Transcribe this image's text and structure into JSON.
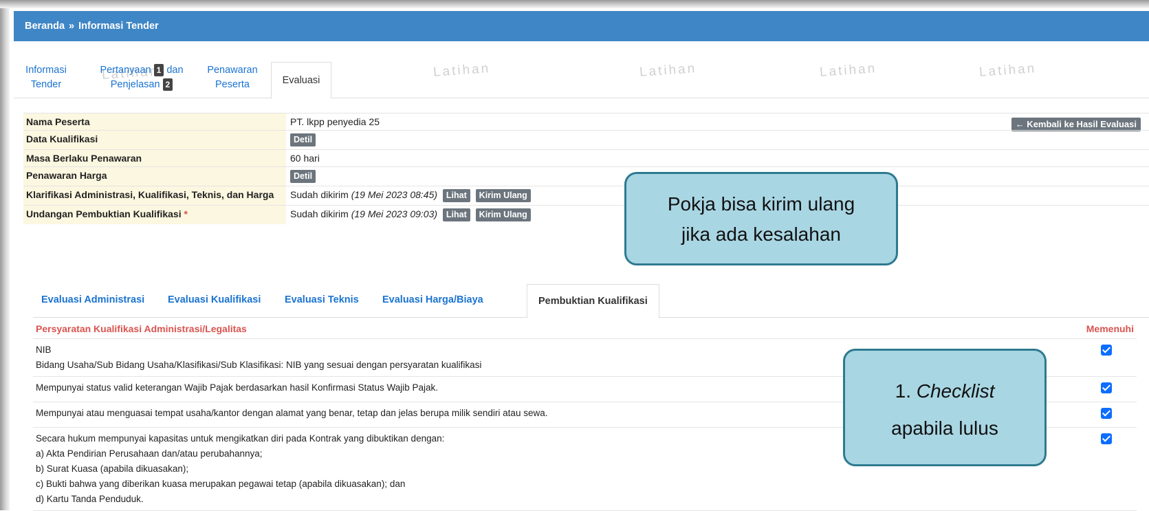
{
  "header": {
    "home": "Beranda",
    "separator": "»",
    "current": "Informasi Tender"
  },
  "tabs": [
    {
      "line1": "Informasi",
      "line2": "Tender"
    },
    {
      "line1": "Pertanyaan",
      "badge1": "1",
      "mid": "dan",
      "line2": "Penjelasan",
      "badge2": "2"
    },
    {
      "line1": "Penawaran",
      "line2": "Peserta"
    },
    {
      "line1": "Evaluasi"
    }
  ],
  "watermark": "Latihan",
  "info": {
    "rows": [
      {
        "label": "Nama Peserta",
        "value": "PT. lkpp penyedia 25"
      },
      {
        "label": "Data Kualifikasi",
        "button": "Detil"
      },
      {
        "label": "Masa Berlaku Penawaran",
        "value": "60 hari"
      },
      {
        "label": "Penawaran Harga",
        "button": "Detil"
      },
      {
        "label": "Klarifikasi Administrasi, Kualifikasi, Teknis, dan Harga",
        "value": "Sudah dikirim",
        "date": "(19 Mei 2023 08:45)",
        "btn1": "Lihat",
        "btn2": "Kirim Ulang"
      },
      {
        "label": "Undangan Pembuktian Kualifikasi",
        "required": "*",
        "value": "Sudah dikirim",
        "date": "(19 Mei 2023 09:03)",
        "btn1": "Lihat",
        "btn2": "Kirim Ulang"
      }
    ],
    "back_button": "← Kembali ke Hasil Evaluasi"
  },
  "subtabs": [
    "Evaluasi Administrasi",
    "Evaluasi Kualifikasi",
    "Evaluasi Teknis",
    "Evaluasi Harga/Biaya",
    "Pembuktian Kualifikasi"
  ],
  "requirements": {
    "header": "Persyaratan Kualifikasi Administrasi/Legalitas",
    "status_header": "Memenuhi",
    "items": [
      {
        "lines": [
          "NIB",
          "Bidang Usaha/Sub Bidang Usaha/Klasifikasi/Sub Klasifikasi: NIB yang sesuai dengan persyaratan kualifikasi"
        ],
        "checked": true
      },
      {
        "lines": [
          "Mempunyai status valid keterangan Wajib Pajak berdasarkan hasil Konfirmasi Status Wajib Pajak."
        ],
        "checked": true
      },
      {
        "lines": [
          "Mempunyai atau menguasai tempat usaha/kantor dengan alamat yang benar, tetap dan jelas berupa milik sendiri atau sewa."
        ],
        "checked": true
      },
      {
        "lines": [
          "Secara hukum mempunyai kapasitas untuk mengikatkan diri pada Kontrak yang dibuktikan dengan:",
          "a) Akta Pendirian Perusahaan dan/atau perubahannya;",
          "b) Surat Kuasa (apabila dikuasakan);",
          "c) Bukti bahwa yang diberikan kuasa merupakan pegawai tetap (apabila dikuasakan); dan",
          "d) Kartu Tanda Penduduk."
        ],
        "checked": true
      }
    ]
  },
  "callouts": {
    "top": {
      "line1": "Pokja bisa kirim ulang",
      "line2": "jika ada kesalahan"
    },
    "bottom": {
      "prefix": "1. ",
      "italic": "Checklist",
      "line2": "apabila lulus"
    }
  },
  "colors": {
    "header_bg": "#3f86c6",
    "link": "#1a73d1",
    "label_bg": "#fcf7e0",
    "callout_bg": "#a9d6e3",
    "callout_border": "#2d7a90",
    "checkbox": "#0d6efd"
  }
}
